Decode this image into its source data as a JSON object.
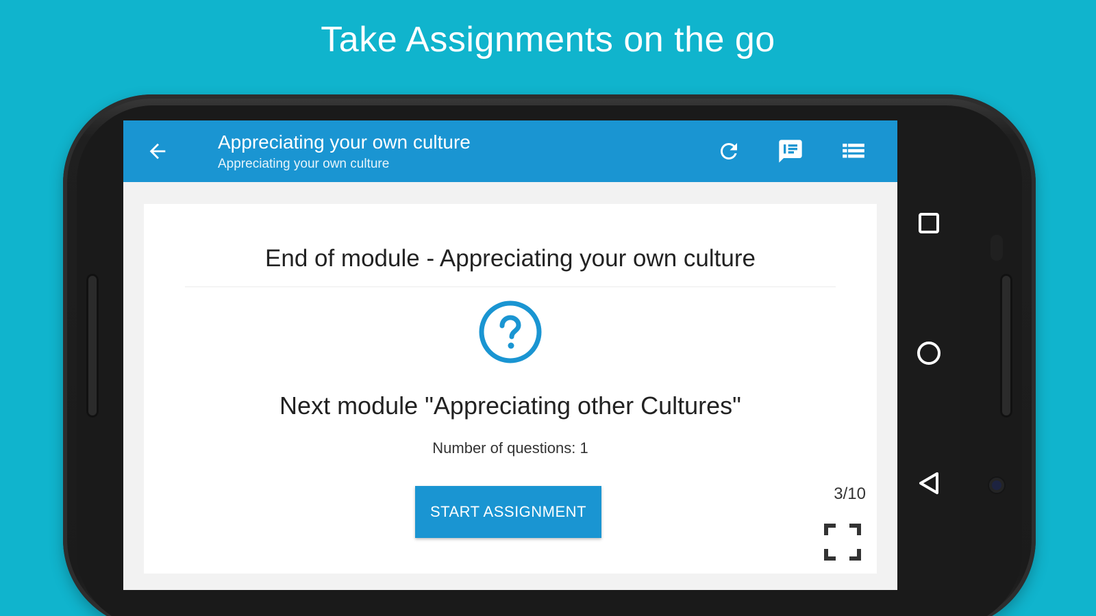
{
  "promo": {
    "headline": "Take Assignments on the go"
  },
  "app_bar": {
    "title": "Appreciating your own culture",
    "subtitle": "Appreciating your own culture",
    "icons": {
      "back": "arrow-back-icon",
      "refresh": "refresh-icon",
      "feedback": "feedback-icon",
      "list": "list-icon"
    }
  },
  "content": {
    "end_module_title": "End of module - Appreciating your own culture",
    "next_module_text": "Next module \"Appreciating other Cultures\"",
    "questions_count": "Number of questions: 1",
    "start_button_label": "START ASSIGNMENT",
    "page_indicator": "3/10",
    "icons": {
      "question": "question-circle-icon",
      "fullscreen": "fullscreen-icon"
    }
  },
  "system_nav": {
    "icons": [
      "recents-icon",
      "home-icon",
      "back-triangle-icon"
    ]
  },
  "colors": {
    "background": "#10b4cd",
    "accent": "#1a95d2",
    "nav_bar": "#1b1b1b",
    "card": "#ffffff"
  }
}
